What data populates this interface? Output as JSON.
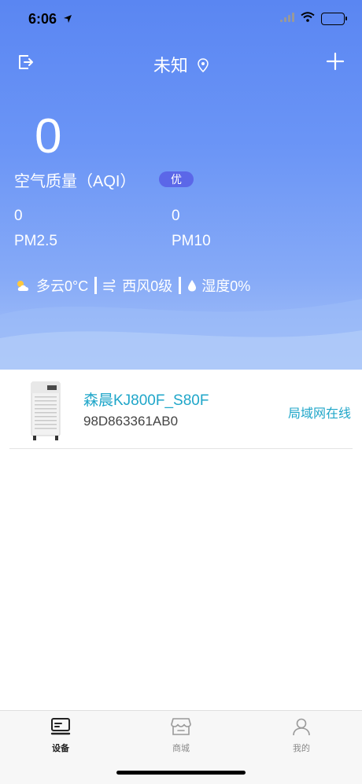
{
  "status_bar": {
    "time": "6:06"
  },
  "nav": {
    "title": "未知"
  },
  "aqi": {
    "value": "0",
    "label": "空气质量（AQI）",
    "badge": "优"
  },
  "pm": {
    "pm25": {
      "value": "0",
      "label": "PM2.5"
    },
    "pm10": {
      "value": "0",
      "label": "PM10"
    }
  },
  "weather": {
    "condition": "多云0°C",
    "wind": "西风0级",
    "humidity": "湿度0%"
  },
  "device": {
    "name": "森晨KJ800F_S80F",
    "id": "98D863361AB0",
    "status": "局域网在线"
  },
  "tabs": [
    {
      "label": "设备",
      "active": true
    },
    {
      "label": "商城",
      "active": false
    },
    {
      "label": "我的",
      "active": false
    }
  ],
  "colors": {
    "accent": "#1fa6c9",
    "badge": "#5b67e8",
    "hero_top": "#5a86f2"
  }
}
